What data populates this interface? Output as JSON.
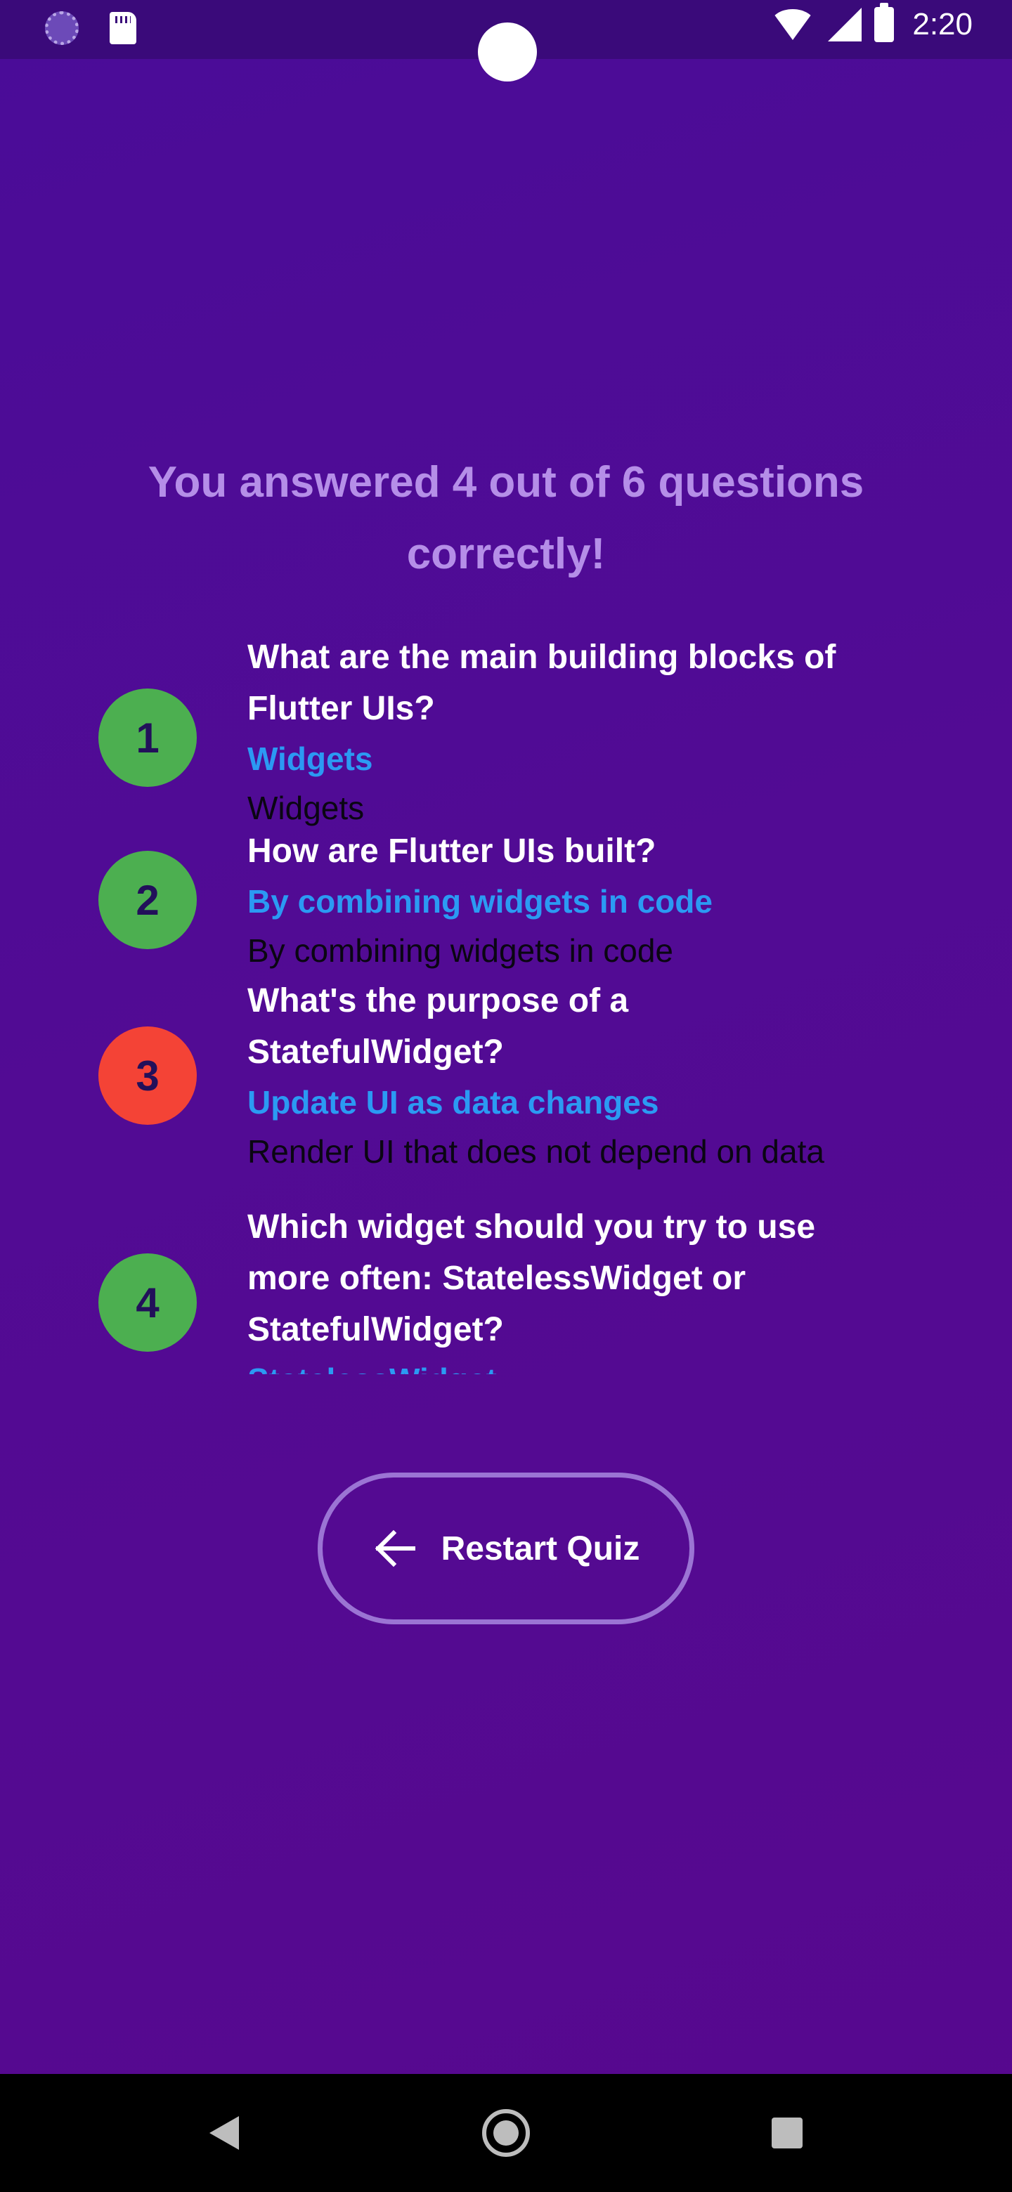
{
  "status_bar": {
    "time": "2:20",
    "icons": [
      "sync-icon",
      "sd-card-icon",
      "wifi-off-icon",
      "signal-icon",
      "battery-icon"
    ]
  },
  "summary": {
    "text": "You answered 4 out of 6 questions correctly!"
  },
  "results": [
    {
      "number": "1",
      "status": "correct",
      "question": "What are the main building blocks of Flutter UIs?",
      "correct_answer": "Widgets",
      "user_answer": "Widgets"
    },
    {
      "number": "2",
      "status": "correct",
      "question": "How are Flutter UIs built?",
      "correct_answer": "By combining widgets in code",
      "user_answer": "By combining widgets in code"
    },
    {
      "number": "3",
      "status": "wrong",
      "question": "What's the purpose of a StatefulWidget?",
      "correct_answer": "Update UI as data changes",
      "user_answer": "Render UI that does not depend on data"
    },
    {
      "number": "4",
      "status": "correct",
      "question": "Which widget should you try to use more often: StatelessWidget or StatefulWidget?",
      "correct_answer": "StatelessWidget",
      "user_answer": ""
    }
  ],
  "restart_button": {
    "label": "Restart Quiz",
    "icon": "arrow-left-icon"
  },
  "nav_bar": {
    "icons": [
      "back-icon",
      "home-icon",
      "recents-icon"
    ]
  },
  "colors": {
    "background": "#520b94",
    "correct_badge": "#4caf50",
    "wrong_badge": "#f44336",
    "correct_answer_text": "#2b9af3",
    "summary_text": "#b58ee8"
  }
}
